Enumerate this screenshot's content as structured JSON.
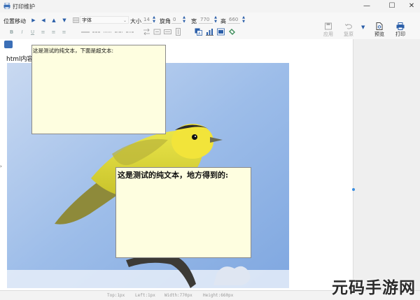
{
  "window": {
    "title": "打印维护",
    "minimize": "—",
    "maximize": "☐",
    "close": "✕"
  },
  "toolbar": {
    "position_label": "位置移动",
    "font_combo": "字体",
    "size_label": "大小",
    "size_value": "14",
    "rotate_label": "旋角",
    "rotate_value": "0",
    "width_label": "宽",
    "width_value": "770",
    "height_label": "高",
    "height_value": "660",
    "apply_label": "应用",
    "reset_label": "复原",
    "preview_label": "预览",
    "print_label": "打印"
  },
  "canvas": {
    "html_label": "html内容",
    "note1_text": "这是测试的纯文本，下面是超文本:",
    "note2_text": "这是测试的纯文本，地方得到的:"
  },
  "status": {
    "top": "Top:1px",
    "left": "Left:1px",
    "width": "Width:770px",
    "height": "Height:660px"
  },
  "watermark": "元码手游网",
  "colors": {
    "accent": "#2a5ea8",
    "note_bg": "#fefee0",
    "sky": "#8fb4e6"
  }
}
